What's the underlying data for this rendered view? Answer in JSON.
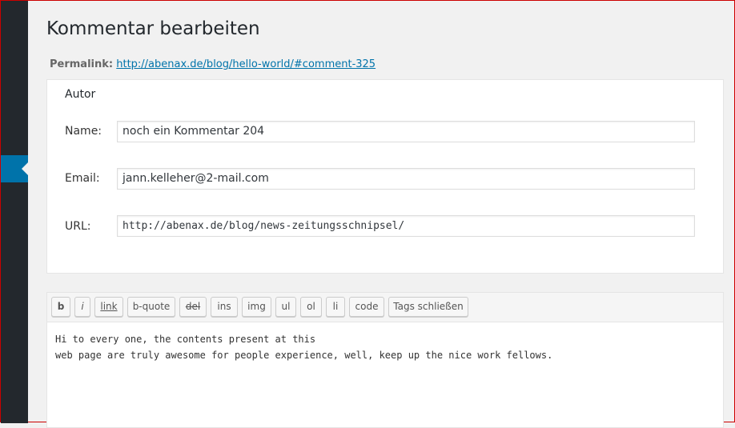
{
  "page": {
    "title": "Kommentar bearbeiten"
  },
  "permalink": {
    "label": "Permalink:",
    "url": "http://abenax.de/blog/hello-world/#comment-325"
  },
  "author": {
    "legend": "Autor",
    "name_label": "Name:",
    "name_value": "noch ein Kommentar 204",
    "email_label": "Email:",
    "email_value": "jann.kelleher@2-mail.com",
    "url_label": "URL:",
    "url_value": "http://abenax.de/blog/news-zeitungsschnipsel/"
  },
  "toolbar": {
    "buttons": [
      "b",
      "i",
      "link",
      "b-quote",
      "del",
      "ins",
      "img",
      "ul",
      "ol",
      "li",
      "code",
      "Tags schließen"
    ]
  },
  "editor": {
    "content": "Hi to every one, the contents present at this\nweb page are truly awesome for people experience, well, keep up the nice work fellows."
  },
  "colors": {
    "sidebar_bg": "#23282d",
    "accent": "#0073aa"
  }
}
